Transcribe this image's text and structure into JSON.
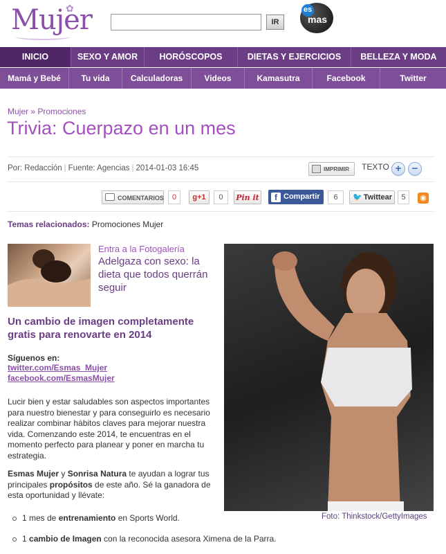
{
  "header": {
    "logo_text": "Mujer",
    "search_placeholder": "",
    "search_button": "IR",
    "esmas_es": "es",
    "esmas_mas": "mas"
  },
  "nav_primary": [
    {
      "label": "INICIO",
      "active": true
    },
    {
      "label": "SEXO Y AMOR"
    },
    {
      "label": "HORÓSCOPOS"
    },
    {
      "label": "DIETAS Y EJERCICIOS"
    },
    {
      "label": "BELLEZA Y MODA"
    }
  ],
  "nav_secondary": [
    {
      "label": "Mamá y Bebé"
    },
    {
      "label": "Tu vida"
    },
    {
      "label": "Calculadoras"
    },
    {
      "label": "Videos"
    },
    {
      "label": "Kamasutra"
    },
    {
      "label": "Facebook"
    },
    {
      "label": "Twitter"
    }
  ],
  "article": {
    "breadcrumb": "Mujer » Promociones",
    "title": "Trivia: Cuerpazo en un mes",
    "author": "Por: Redacción",
    "source": "Fuente: Agencias",
    "date": "2014-01-03 16:45",
    "print_label": "IMPRIMIR",
    "text_label": "TEXTO",
    "size_plus": "+",
    "size_minus": "−",
    "temas_label": "Temas relacionados:",
    "temas_value": "Promociones Mujer",
    "gallery_label": "Entra a la Fotogalería",
    "gallery_title": "Adelgaza con sexo: la dieta que todos querrán seguir",
    "subtitle": "Un cambio de imagen completamente gratis para renovarte en 2014",
    "follow_label": "Síguenos en:",
    "twitter_link": "twitter.com/Esmas_Mujer",
    "facebook_link": "facebook.com/EsmasMujer",
    "paragraph1": "Lucir bien y estar saludables son aspectos importantes para nuestro bienestar y para conseguirlo es necesario realizar combinar hábitos claves para mejorar nuestra vida. Comenzando este 2014, te encuentras en el momento perfecto para planear y poner en marcha tu estrategia.",
    "p2_brand1": "Esmas Mujer",
    "p2_y": " y ",
    "p2_brand2": "Sonrisa Natura",
    "p2_text1": " te ayudan a lograr tus principales ",
    "p2_bold": "propósitos",
    "p2_text2": " de este año. Sé la ganadora de esta oportunidad y llévate:",
    "bullet1_pre": "1 mes de ",
    "bullet1_bold": "entrenamiento",
    "bullet1_post": " en Sports World.",
    "bullet2_pre": "1 ",
    "bullet2_bold": "cambio de Imagen",
    "bullet2_post": " con la reconocida asesora Ximena de la Parra.",
    "photo_caption": "Foto: Thinkstock/GettyImages"
  },
  "share": {
    "comments_label": "COMENTARIOS",
    "comments_count": "0",
    "gplus_label": "g+1",
    "gplus_count": "0",
    "pinit_label": "Pin it",
    "fb_label": "Compartir",
    "fb_count": "6",
    "tw_label": "Twittear",
    "tw_count": "5"
  },
  "colors": {
    "brand_purple": "#6b3d84",
    "title_purple": "#a34fbf",
    "facebook_blue": "#3b5998",
    "rss_orange": "#f08a1e"
  }
}
